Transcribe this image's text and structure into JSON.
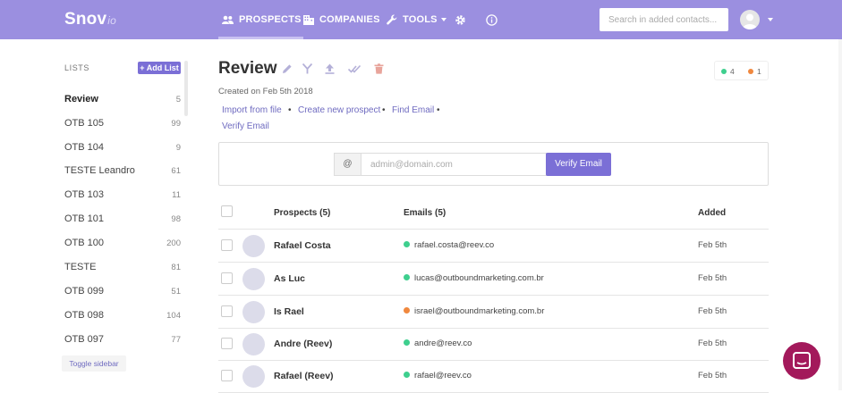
{
  "app": {
    "logo": "Snov",
    "logo_suffix": "io"
  },
  "nav": {
    "prospects": "PROSPECTS",
    "companies": "COMPANIES",
    "tools": "TOOLS"
  },
  "search": {
    "placeholder": "Search in added contacts..."
  },
  "sidebar": {
    "title": "LISTS",
    "add_list": "+ Add List",
    "toggle": "Toggle sidebar",
    "items": [
      {
        "name": "Review",
        "count": "5"
      },
      {
        "name": "OTB 105",
        "count": "99"
      },
      {
        "name": "OTB 104",
        "count": "9"
      },
      {
        "name": "TESTE Leandro",
        "count": "61"
      },
      {
        "name": "OTB 103",
        "count": "11"
      },
      {
        "name": "OTB 101",
        "count": "98"
      },
      {
        "name": "OTB 100",
        "count": "200"
      },
      {
        "name": "TESTE",
        "count": "81"
      },
      {
        "name": "OTB 099",
        "count": "51"
      },
      {
        "name": "OTB 098",
        "count": "104"
      },
      {
        "name": "OTB 097",
        "count": "77"
      }
    ]
  },
  "page": {
    "title": "Review",
    "created": "Created on Feb 5th 2018",
    "badge_green": "4",
    "badge_orange": "1"
  },
  "actions": {
    "import": "Import from file",
    "create": "Create new prospect",
    "find": "Find Email",
    "verify": "Verify Email",
    "separator": "•"
  },
  "verify_panel": {
    "at": "@",
    "placeholder": "admin@domain.com",
    "button": "Verify Email"
  },
  "table": {
    "headers": {
      "prospects": "Prospects (5)",
      "emails": "Emails (5)",
      "added": "Added"
    },
    "rows": [
      {
        "name": "Rafael Costa",
        "email": "rafael.costa@reev.co",
        "status": "green",
        "added": "Feb 5th"
      },
      {
        "name": "As Luc",
        "email": "lucas@outboundmarketing.com.br",
        "status": "green",
        "added": "Feb 5th"
      },
      {
        "name": "Is Rael",
        "email": "israel@outboundmarketing.com.br",
        "status": "orange",
        "added": "Feb 5th"
      },
      {
        "name": "Andre (Reev)",
        "email": "andre@reev.co",
        "status": "green",
        "added": "Feb 5th"
      },
      {
        "name": "Rafael (Reev)",
        "email": "rafael@reev.co",
        "status": "green",
        "added": "Feb 5th"
      }
    ]
  },
  "colors": {
    "brand": "#9b8fe0",
    "accent": "#7b6fd6",
    "status_green": "#3ecf8e",
    "status_orange": "#f0883e",
    "chat": "#a3195b"
  }
}
